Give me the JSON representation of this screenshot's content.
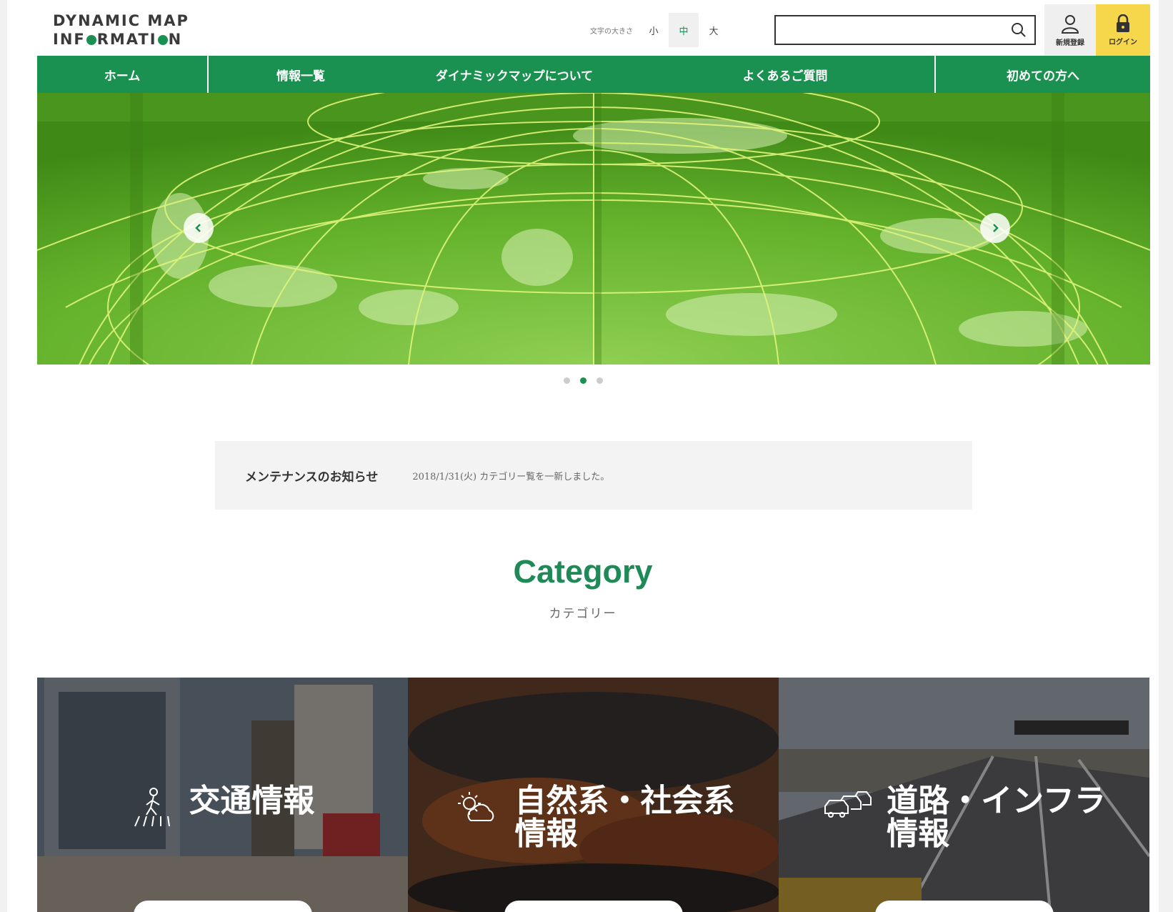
{
  "logo": {
    "line1": "DYNAMIC MAP",
    "line2_a": "INF",
    "line2_b": "RMATI",
    "line2_c": "N"
  },
  "font_size": {
    "label": "文字の大きさ",
    "small": "小",
    "medium": "中",
    "large": "大"
  },
  "search": {
    "value": "",
    "placeholder": ""
  },
  "header_buttons": {
    "signup": "新規登録",
    "login": "ログイン"
  },
  "nav": {
    "items": [
      "ホーム",
      "情報一覧",
      "ダイナミックマップについて",
      "よくあるご質問",
      "初めての方へ"
    ]
  },
  "slider": {
    "dots": 3,
    "active_index": 1
  },
  "notice": {
    "title": "メンテナンスのお知らせ",
    "text": "2018/1/31(火) カテゴリー覧を一新しました。"
  },
  "category": {
    "title": "Category",
    "subtitle": "カテゴリー"
  },
  "cards": [
    {
      "label_line1": "交通情報",
      "label_line2": "",
      "icon": "pedestrian-crossing-icon"
    },
    {
      "label_line1": "自然系・社会系",
      "label_line2": "情報",
      "icon": "weather-icon"
    },
    {
      "label_line1": "道路・インフラ",
      "label_line2": "情報",
      "icon": "traffic-jam-icon"
    }
  ],
  "colors": {
    "brand_green": "#1a9150",
    "login_yellow": "#f6d64a",
    "category_green": "#1f8a57"
  }
}
